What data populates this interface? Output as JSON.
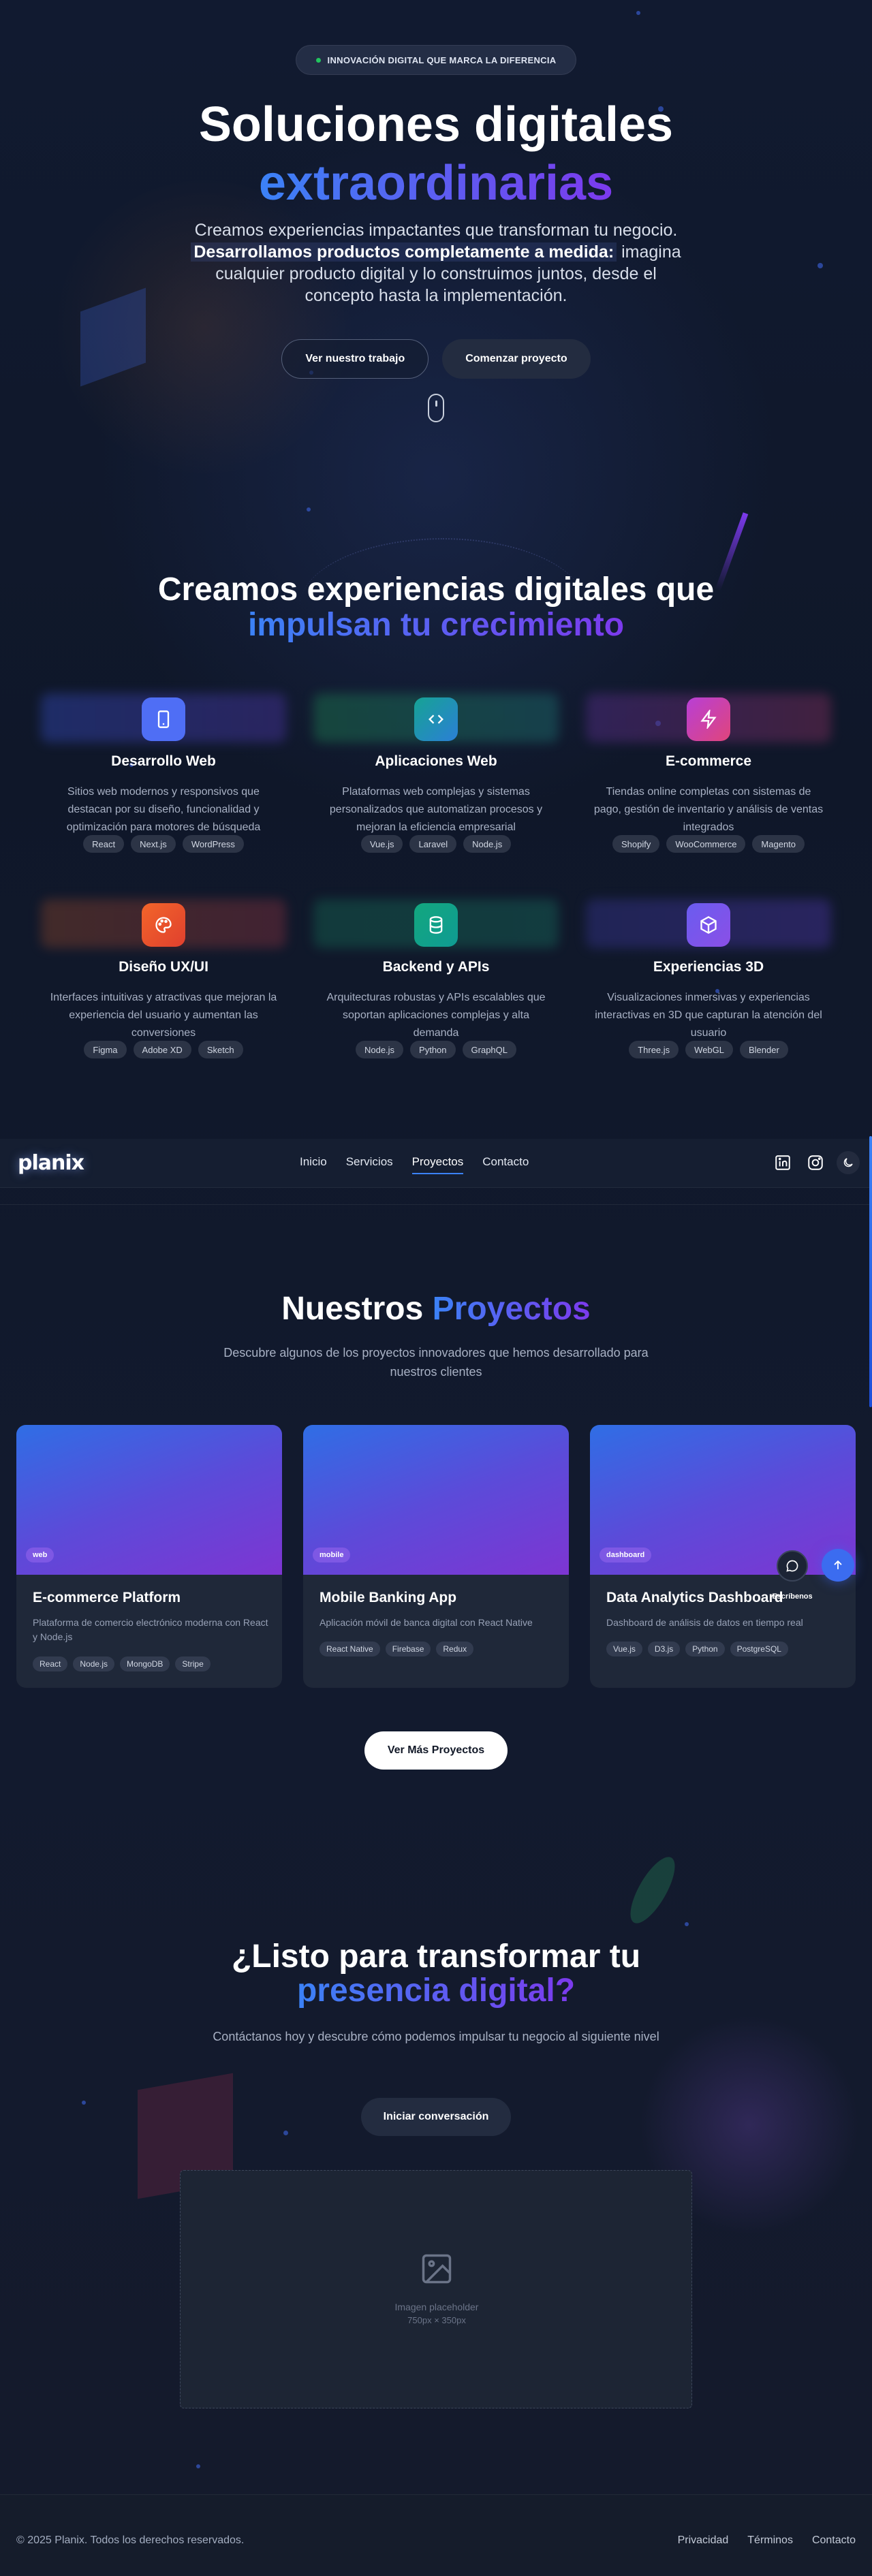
{
  "hero": {
    "badge": "INNOVACIÓN DIGITAL QUE MARCA LA DIFERENCIA",
    "title_line1": "Soluciones digitales",
    "title_line2": "extraordinarias",
    "lead_part1": "Creamos experiencias impactantes que transforman tu negocio.",
    "lead_highlight": "Desarrollamos productos completamente a medida:",
    "lead_part2": "imagina cualquier producto digital y lo construimos juntos, desde el concepto hasta la implementación.",
    "btn_work": "Ver nuestro trabajo",
    "btn_start": "Comenzar proyecto"
  },
  "services": {
    "title_line1": "Creamos experiencias digitales que",
    "title_line2": "impulsan tu crecimiento",
    "items": [
      {
        "title": "Desarrollo Web",
        "desc": "Sitios web modernos y responsivos que destacan por su diseño, funcionalidad y optimización para motores de búsqueda",
        "tags": [
          "React",
          "Next.js",
          "WordPress"
        ],
        "icon": "smartphone-icon",
        "color": "#4f6ef5"
      },
      {
        "title": "Aplicaciones Web",
        "desc": "Plataformas web complejas y sistemas personalizados que automatizan procesos y mejoran la eficiencia empresarial",
        "tags": [
          "Vue.js",
          "Laravel",
          "Node.js"
        ],
        "icon": "code-icon",
        "color": "#16a394"
      },
      {
        "title": "E-commerce",
        "desc": "Tiendas online completas con sistemas de pago, gestión de inventario y análisis de ventas integrados",
        "tags": [
          "Shopify",
          "WooCommerce",
          "Magento"
        ],
        "icon": "lightning-icon",
        "color": "#c43fd0"
      },
      {
        "title": "Diseño UX/UI",
        "desc": "Interfaces intuitivas y atractivas que mejoran la experiencia del usuario y aumentan las conversiones",
        "tags": [
          "Figma",
          "Adobe XD",
          "Sketch"
        ],
        "icon": "palette-icon",
        "color": "#ef5a27"
      },
      {
        "title": "Backend y APIs",
        "desc": "Arquitecturas robustas y APIs escalables que soportan aplicaciones complejas y alta demanda",
        "tags": [
          "Node.js",
          "Python",
          "GraphQL"
        ],
        "icon": "database-icon",
        "color": "#13a77e"
      },
      {
        "title": "Experiencias 3D",
        "desc": "Visualizaciones inmersivas y experiencias interactivas en 3D que capturan la atención del usuario",
        "tags": [
          "Three.js",
          "WebGL",
          "Blender"
        ],
        "icon": "cube-icon",
        "color": "#7b5cf0"
      }
    ]
  },
  "nav": {
    "logo": "planix",
    "links": [
      "Inicio",
      "Servicios",
      "Proyectos",
      "Contacto"
    ],
    "active": "Proyectos"
  },
  "projects": {
    "title_part1": "Nuestros",
    "title_part2": "Proyectos",
    "subtitle": "Descubre algunos de los proyectos innovadores que hemos desarrollado para nuestros clientes",
    "items": [
      {
        "category": "web",
        "title": "E-commerce Platform",
        "desc": "Plataforma de comercio electrónico moderna con React y Node.js",
        "tags": [
          "React",
          "Node.js",
          "MongoDB",
          "Stripe"
        ]
      },
      {
        "category": "mobile",
        "title": "Mobile Banking App",
        "desc": "Aplicación móvil de banca digital con React Native",
        "tags": [
          "React Native",
          "Firebase",
          "Redux"
        ]
      },
      {
        "category": "dashboard",
        "title": "Data Analytics Dashboard",
        "desc": "Dashboard de análisis de datos en tiempo real",
        "tags": [
          "Vue.js",
          "D3.js",
          "Python",
          "PostgreSQL"
        ]
      }
    ],
    "more_button": "Ver Más Proyectos",
    "chat_label": "Escríbenos"
  },
  "cta": {
    "title_line1": "¿Listo para transformar tu",
    "title_line2": "presencia digital?",
    "subtitle": "Contáctanos hoy y descubre cómo podemos impulsar tu negocio al siguiente nivel",
    "button": "Iniciar conversación",
    "placeholder_label": "Imagen placeholder",
    "placeholder_size": "750px × 350px"
  },
  "footer": {
    "copyright": "© 2025 Planix. Todos los derechos reservados.",
    "links": [
      "Privacidad",
      "Términos",
      "Contacto"
    ]
  }
}
